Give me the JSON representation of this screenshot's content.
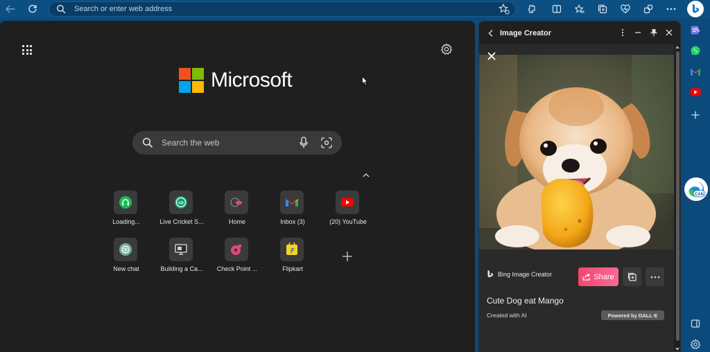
{
  "toolbar": {
    "address_placeholder": "Search or enter web address"
  },
  "ntp": {
    "brand": "Microsoft",
    "search_placeholder": "Search the web",
    "tiles": [
      {
        "label": "Loading...",
        "icon": "headphones-icon",
        "color": "#1db954"
      },
      {
        "label": "Live Cricket S...",
        "icon": "cricbuzz-icon",
        "color": "#0b9e6a"
      },
      {
        "label": "Home",
        "icon": "home-site-icon",
        "color": "#e0467f"
      },
      {
        "label": "Inbox (3)",
        "icon": "gmail-icon",
        "color": "#ea4335"
      },
      {
        "label": "(20) YouTube",
        "icon": "youtube-icon",
        "color": "#ff0000"
      },
      {
        "label": "New chat",
        "icon": "chatgpt-icon",
        "color": "#74aa9c"
      },
      {
        "label": "Building a Ca...",
        "icon": "monitor-icon",
        "color": "#e6e6e6"
      },
      {
        "label": "Check Point ...",
        "icon": "checkpoint-icon",
        "color": "#e0467f"
      },
      {
        "label": "Flipkart",
        "icon": "flipkart-icon",
        "color": "#f8d31b"
      }
    ]
  },
  "panel": {
    "title": "Image Creator",
    "brand_label": "Bing Image Creator",
    "share_label": "Share",
    "caption": "Cute Dog eat Mango",
    "created_with": "Created with AI",
    "powered_by": "Powered by DALL·E"
  },
  "rail": {
    "avatar_badge": "CAN"
  },
  "colors": {
    "frame": "#0b4a7a",
    "ntp_bg": "#1f1f1f",
    "panel_bg": "#2a2a2a",
    "share_gradient_start": "#f2466f",
    "share_gradient_end": "#f76a98"
  }
}
